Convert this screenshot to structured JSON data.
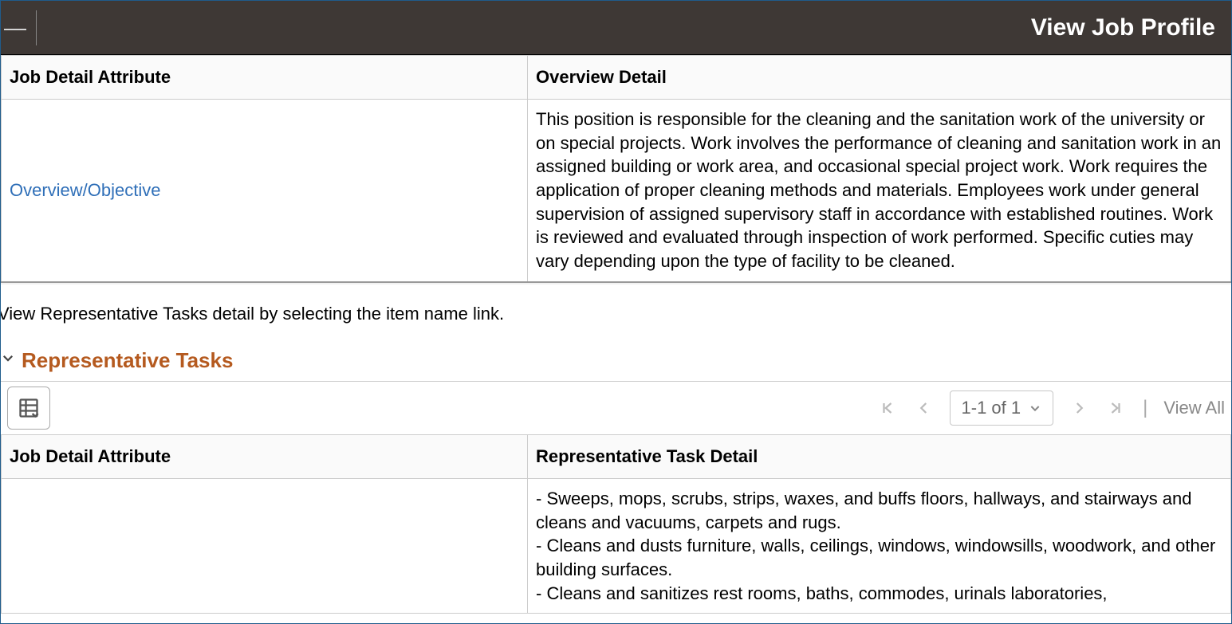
{
  "header": {
    "title": "View Job Profile"
  },
  "overview_table": {
    "col_attr": "Job Detail Attribute",
    "col_detail": "Overview Detail",
    "row": {
      "attr_link": "Overview/Objective",
      "detail": "This position is responsible for the cleaning and the sanitation work of the university or on special projects. Work involves the performance of cleaning and sanitation work in an assigned building or work area, and occasional special project work. Work requires the application of proper cleaning methods and materials. Employees work under general supervision of assigned supervisory staff in accordance with established routines. Work is reviewed and evaluated through inspection of work performed. Specific cuties may vary depending upon the type of facility to be cleaned."
    }
  },
  "instruction": "View Representative Tasks detail by selecting the item name link.",
  "tasks_section": {
    "title": "Representative Tasks",
    "pager": {
      "range": "1-1 of 1",
      "view_all": "View All"
    },
    "col_attr": "Job Detail Attribute",
    "col_detail": "Representative Task Detail",
    "row": {
      "detail": "- Sweeps, mops, scrubs, strips, waxes, and buffs floors, hallways, and stairways and cleans and vacuums, carpets and rugs.\n- Cleans and dusts furniture, walls, ceilings, windows, windowsills, woodwork, and other building surfaces.\n- Cleans and sanitizes rest rooms, baths, commodes, urinals laboratories,"
    }
  }
}
